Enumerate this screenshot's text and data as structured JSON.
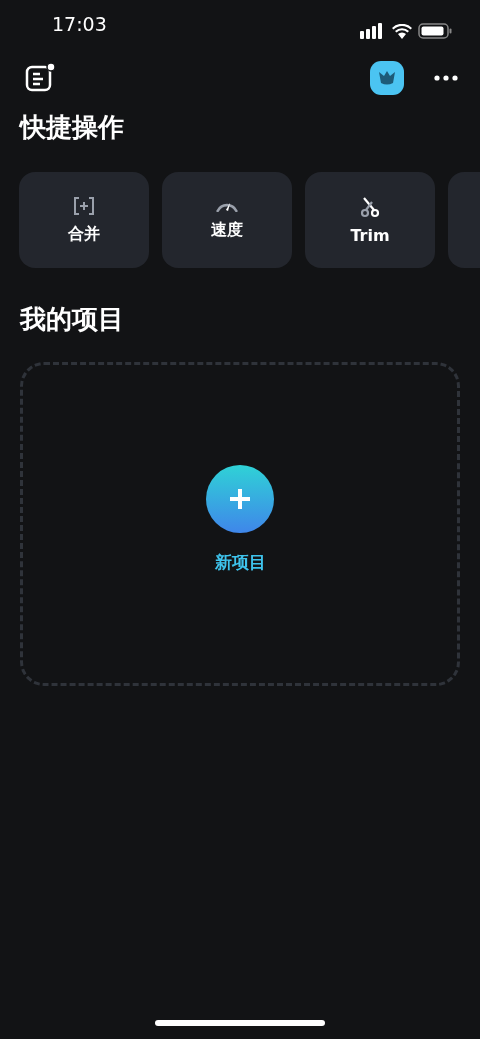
{
  "status_bar": {
    "time": "17:03"
  },
  "quick_actions": {
    "title": "快捷操作",
    "items": [
      {
        "kind": "merge",
        "label": "合并"
      },
      {
        "kind": "speed",
        "label": "速度"
      },
      {
        "kind": "trim",
        "label": "Trim"
      }
    ]
  },
  "projects": {
    "title": "我的项目",
    "new_project": {
      "label": "新项目"
    }
  }
}
